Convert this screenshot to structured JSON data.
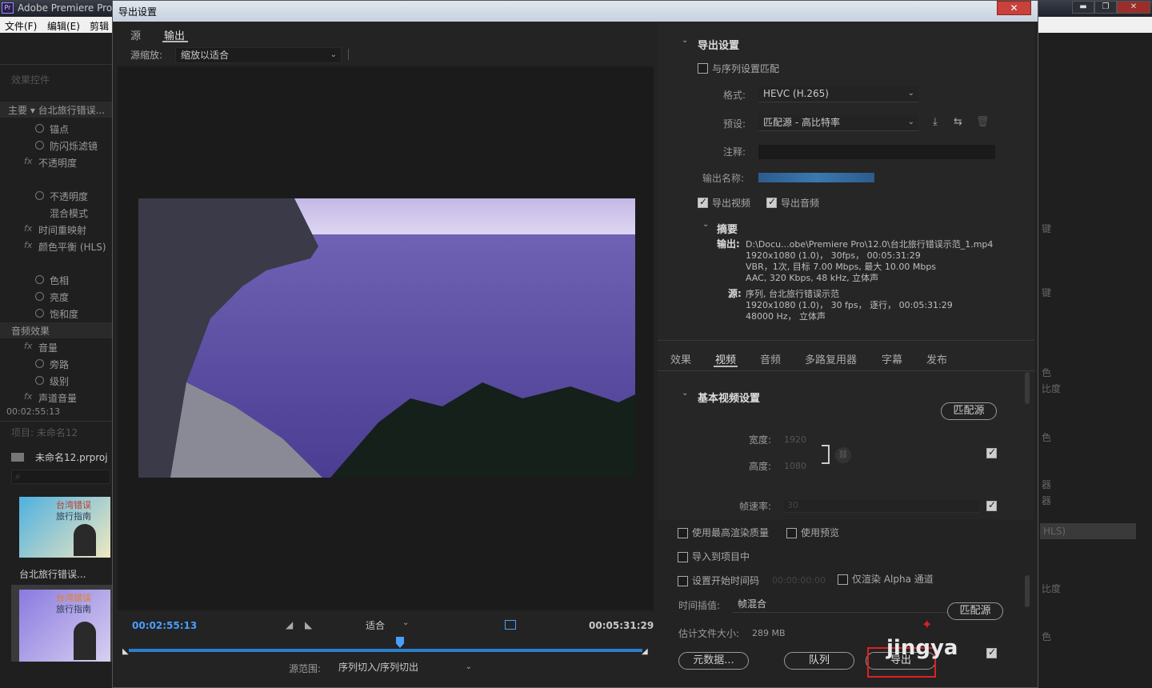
{
  "app": {
    "title": "Adobe Premiere Pro",
    "menu": [
      "文件(F)",
      "编辑(E)",
      "剪辑"
    ],
    "win_min": "▬",
    "win_max": "❐",
    "win_close": "✕"
  },
  "left_panel": {
    "tab_label": "效果控件",
    "master_label": "主要 ▾ 台北旅行错误...",
    "items": [
      {
        "label": "锚点"
      },
      {
        "label": "防闪烁滤镜"
      },
      {
        "label": "不透明度"
      },
      {
        "label": "不透明度"
      },
      {
        "label": "混合模式"
      },
      {
        "label": "时间重映射"
      },
      {
        "label": "颜色平衡 (HLS)"
      },
      {
        "label": "色相"
      },
      {
        "label": "亮度"
      },
      {
        "label": "饱和度"
      },
      {
        "label": "音频效果"
      },
      {
        "label": "音量"
      },
      {
        "label": "旁路"
      },
      {
        "label": "级别"
      },
      {
        "label": "声道音量"
      }
    ],
    "timecode": "00:02:55:13",
    "project_label": "项目: 未命名12",
    "project_file": "未命名12.prproj",
    "thumb1_label": "台北旅行错误...",
    "thumb_text": "台湾错误",
    "thumb_text2": "旅行指南"
  },
  "right_bg": {
    "labels": [
      "键",
      "键",
      "色",
      "比度",
      "色",
      "器",
      "器",
      "HLS)",
      "比度",
      "色"
    ]
  },
  "dialog": {
    "title": "导出设置",
    "close": "✕",
    "tabs": {
      "source": "源",
      "output": "输出"
    },
    "source_scale_label": "源缩放:",
    "source_scale_value": "缩放以适合",
    "timecode_start": "00:02:55:13",
    "timecode_end": "00:05:31:29",
    "fit_value": "适合",
    "range_label": "源范围:",
    "range_value": "序列切入/序列切出",
    "export_settings": {
      "title": "导出设置",
      "match_sequence": "与序列设置匹配",
      "format_label": "格式:",
      "format_value": "HEVC (H.265)",
      "preset_label": "预设:",
      "preset_value": "匹配源 - 高比特率",
      "comments_label": "注释:",
      "output_name_label": "输出名称:",
      "export_video": "导出视频",
      "export_audio": "导出音频"
    },
    "summary": {
      "title": "摘要",
      "output_label": "输出:",
      "output_lines": [
        "D:\\Docu...obe\\Premiere Pro\\12.0\\台北旅行错误示范_1.mp4",
        "1920x1080 (1.0)， 30fps， 00:05:31:29",
        "VBR，1次, 目标 7.00 Mbps, 最大 10.00 Mbps",
        "AAC, 320 Kbps, 48 kHz, 立体声"
      ],
      "source_label": "源:",
      "source_lines": [
        "序列, 台北旅行错误示范",
        "1920x1080 (1.0)， 30 fps， 逐行， 00:05:31:29",
        "48000 Hz， 立体声"
      ]
    },
    "settings_tabs": [
      "效果",
      "视频",
      "音频",
      "多路复用器",
      "字幕",
      "发布"
    ],
    "basic_video": {
      "title": "基本视频设置",
      "match_source": "匹配源",
      "width_label": "宽度:",
      "width_value": "1920",
      "height_label": "高度:",
      "height_value": "1080",
      "framerate_label": "帧速率:",
      "framerate_value": "30"
    },
    "bottom": {
      "max_render": "使用最高渲染质量",
      "use_preview": "使用预览",
      "import_project": "导入到项目中",
      "set_timecode": "设置开始时间码",
      "timecode_val": "00:00:00:00",
      "alpha_only": "仅渲染 Alpha 通道",
      "interp_label": "时间插值:",
      "interp_value": "帧混合",
      "match_source": "匹配源",
      "filesize_label": "估计文件大小:",
      "filesize_value": "289 MB",
      "metadata_btn": "元数据...",
      "queue_btn": "队列",
      "export_btn": "导出",
      "watermark": "jingya"
    }
  },
  "colors": {
    "accent_blue": "#2b7fcf",
    "timecode_blue": "#4a9eff",
    "highlight_red": "#e02020"
  }
}
